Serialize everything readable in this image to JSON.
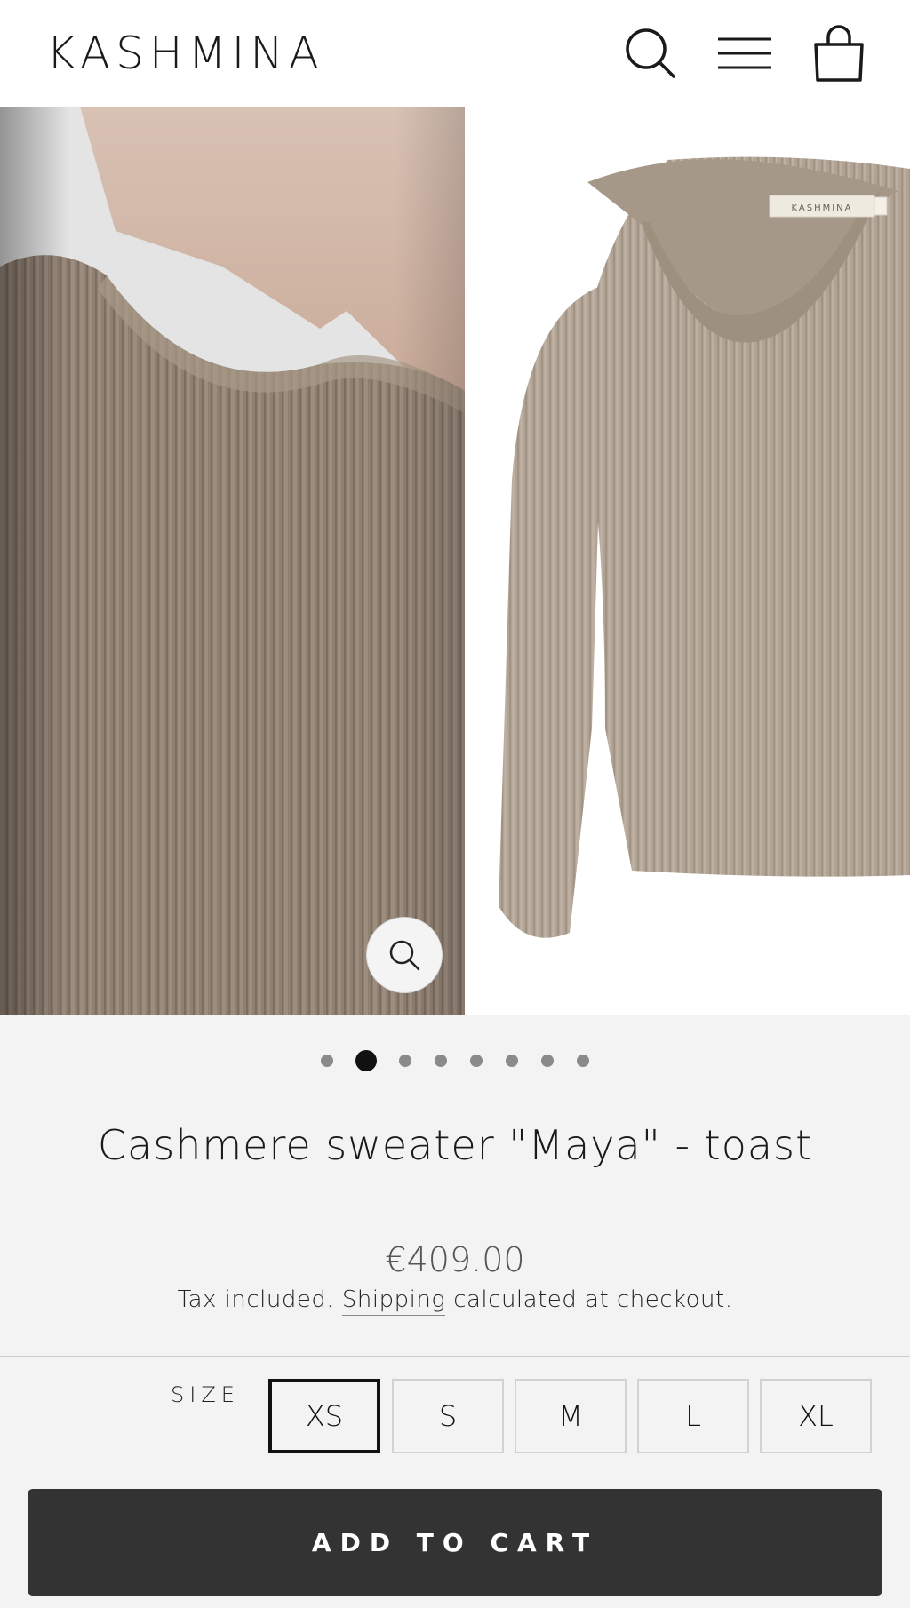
{
  "header": {
    "logo": "KASHMINA",
    "icons": [
      "search-icon",
      "menu-icon",
      "cart-bag-icon"
    ]
  },
  "gallery": {
    "slides": [
      {
        "alt": "model-closeup",
        "colors": {
          "knit": "#8e7f72"
        }
      },
      {
        "alt": "product-front",
        "label_text": "KASHMINA",
        "colors": {
          "knit": "#b3a596"
        }
      }
    ],
    "dots_count": 8,
    "active_dot": 2
  },
  "product": {
    "title": "Cashmere sweater \"Maya\" - toast",
    "price": "€409.00",
    "tax_prefix": "Tax included. ",
    "shipping_link": "Shipping",
    "tax_suffix": " calculated at checkout."
  },
  "size": {
    "label": "SIZE",
    "options": [
      "XS",
      "S",
      "M",
      "L",
      "XL"
    ],
    "selected": "XS"
  },
  "cart": {
    "button_label": "ADD TO CART"
  },
  "colors": {
    "button_bg": "#333333",
    "page_bg": "#f3f3f3"
  }
}
